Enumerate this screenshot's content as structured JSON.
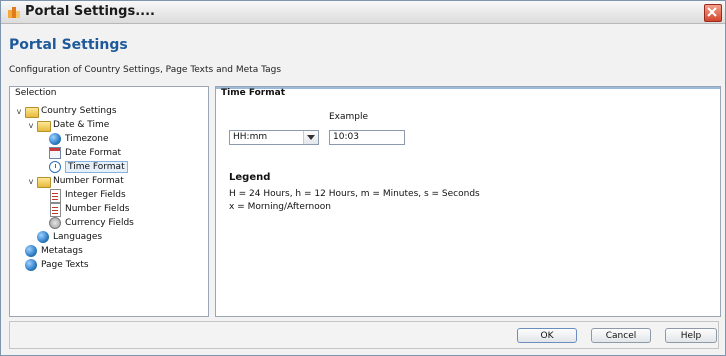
{
  "window": {
    "title": "Portal Settings....",
    "colors": {
      "header_title": "#1e5a9a",
      "title_bar": "#dcdcdc",
      "close_button": "#d2462c"
    }
  },
  "header": {
    "title": "Portal Settings",
    "subtitle": "Configuration of Country Settings, Page Texts and Meta Tags"
  },
  "selection": {
    "title": "Selection",
    "tree": [
      {
        "label": "Country Settings",
        "icon": "folder-icon",
        "toggle": "v"
      },
      {
        "label": "Date & Time",
        "icon": "folder-icon",
        "toggle": "v"
      },
      {
        "label": "Timezone",
        "icon": "globe-icon"
      },
      {
        "label": "Date Format",
        "icon": "date-format-icon"
      },
      {
        "label": "Time Format",
        "icon": "clock-icon",
        "selected": true
      },
      {
        "label": "Number Format",
        "icon": "folder-icon",
        "toggle": "v"
      },
      {
        "label": "Integer Fields",
        "icon": "document-icon"
      },
      {
        "label": "Number Fields",
        "icon": "document-icon"
      },
      {
        "label": "Currency Fields",
        "icon": "coin-icon"
      },
      {
        "label": "Languages",
        "icon": "globe-icon"
      },
      {
        "label": "Metatags",
        "icon": "globe-icon"
      },
      {
        "label": "Page Texts",
        "icon": "globe-icon"
      }
    ]
  },
  "time_format": {
    "title": "Time Format",
    "example_label": "Example",
    "format_value": "HH:mm",
    "example_value": "10:03",
    "legend_title": "Legend",
    "legend_lines": [
      "H = 24 Hours, h = 12 Hours, m = Minutes, s = Seconds",
      "x = Morning/Afternoon"
    ]
  },
  "footer": {
    "ok_label": "OK",
    "cancel_label": "Cancel",
    "help_label": "Help"
  }
}
